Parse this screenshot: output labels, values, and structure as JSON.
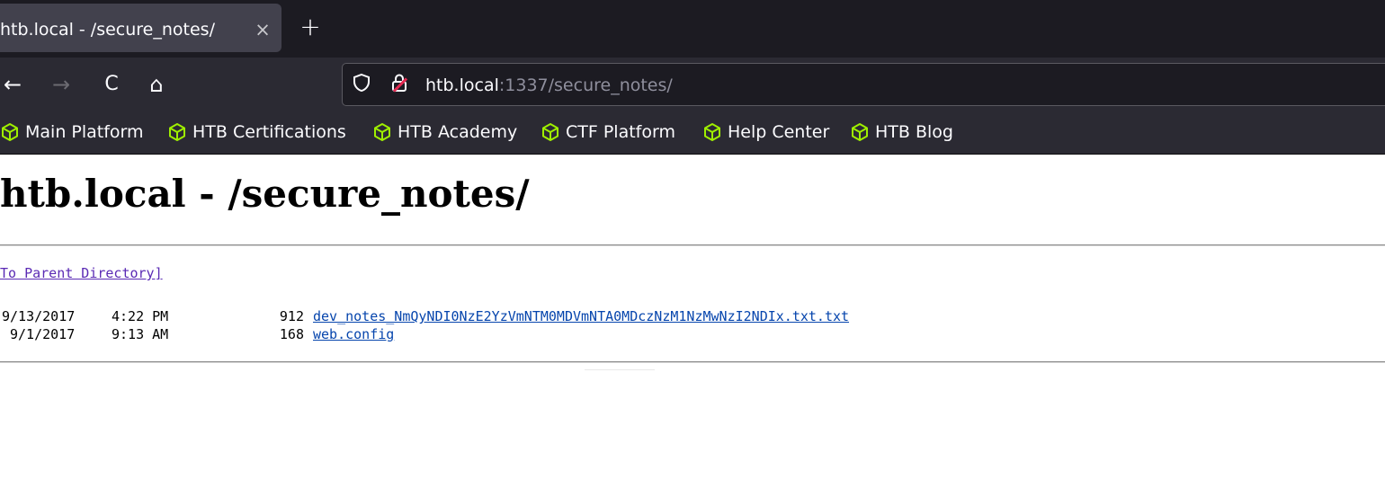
{
  "browser": {
    "tab": {
      "title": "htb.local - /secure_notes/",
      "close_glyph": "×"
    },
    "new_tab_glyph": "+",
    "nav": {
      "back_glyph": "←",
      "forward_glyph": "→",
      "reload_glyph": "C",
      "home_glyph": "⌂"
    },
    "url": {
      "host": "htb.local",
      "path": ":1337/secure_notes/"
    },
    "bookmarks": [
      {
        "label": "Main Platform",
        "icon": "htb-cube-icon"
      },
      {
        "label": "HTB Certifications",
        "icon": "htb-cube-icon"
      },
      {
        "label": "HTB Academy",
        "icon": "htb-cube-icon"
      },
      {
        "label": "CTF Platform",
        "icon": "htb-cube-icon"
      },
      {
        "label": "Help Center",
        "icon": "htb-cube-icon"
      },
      {
        "label": "HTB Blog",
        "icon": "htb-cube-icon"
      }
    ],
    "colors": {
      "bookmark_icon": "#9fef00",
      "insecure_slash": "#e22850"
    }
  },
  "page": {
    "title": "htb.local - /secure_notes/",
    "parent_link": "To Parent Directory]",
    "files": [
      {
        "date": "9/13/2017",
        "time": "4:22 PM",
        "size": "912",
        "name": "dev_notes_NmQyNDI0NzE2YzVmNTM0MDVmNTA0MDczNzM1NzMwNzI2NDIx.txt.txt"
      },
      {
        "date": "9/1/2017",
        "time": "9:13 AM",
        "size": "168",
        "name": "web.config"
      }
    ]
  }
}
